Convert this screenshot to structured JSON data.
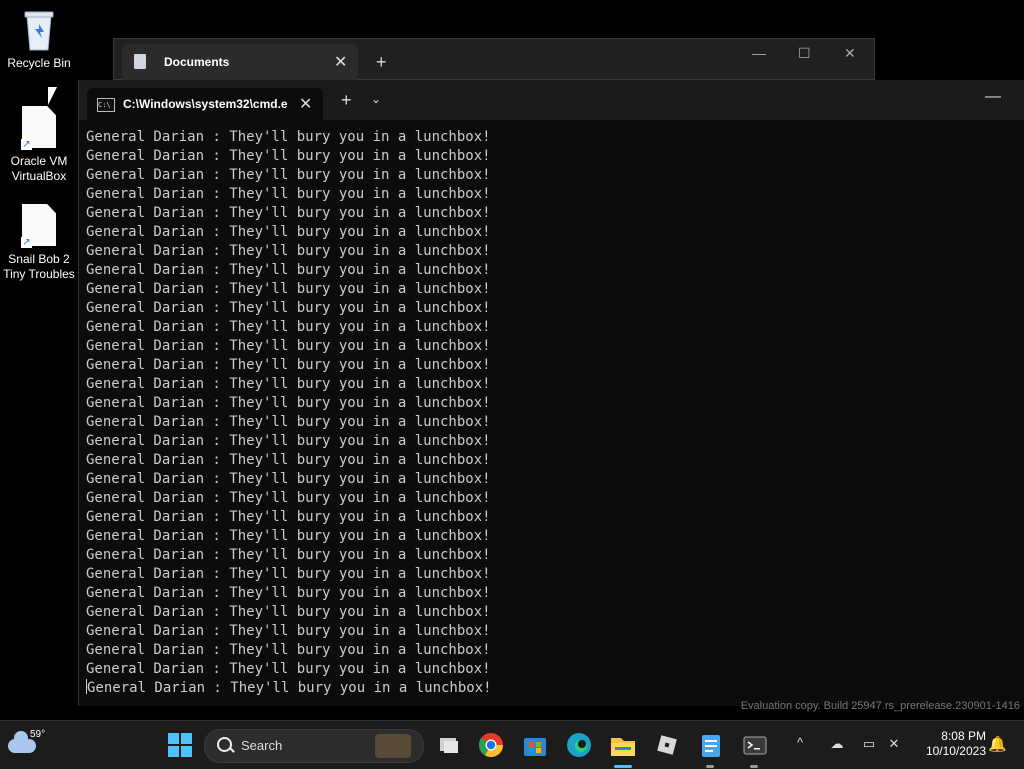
{
  "desktop": {
    "icons": [
      {
        "label": "Recycle Bin",
        "icon": "recycle-bin-icon"
      },
      {
        "label": "Oracle VM VirtualBox",
        "icon": "shortcut-file-icon"
      },
      {
        "label": "Snail Bob 2 Tiny Troubles",
        "icon": "shortcut-file-icon"
      }
    ]
  },
  "documents_window": {
    "tab_title": "Documents",
    "new_tab": "+",
    "close_tab": "✕",
    "minimize": "—",
    "maximize": "☐",
    "close": "✕"
  },
  "terminal": {
    "tab_title": "C:\\Windows\\system32\\cmd.e:",
    "new_tab": "+",
    "dropdown": "⌄",
    "close_tab": "✕",
    "minimize": "—",
    "lines": [
      "General Darian : They'll bury you in a lunchbox!",
      "General Darian : They'll bury you in a lunchbox!",
      "General Darian : They'll bury you in a lunchbox!",
      "General Darian : They'll bury you in a lunchbox!",
      "General Darian : They'll bury you in a lunchbox!",
      "General Darian : They'll bury you in a lunchbox!",
      "General Darian : They'll bury you in a lunchbox!",
      "General Darian : They'll bury you in a lunchbox!",
      "General Darian : They'll bury you in a lunchbox!",
      "General Darian : They'll bury you in a lunchbox!",
      "General Darian : They'll bury you in a lunchbox!",
      "General Darian : They'll bury you in a lunchbox!",
      "General Darian : They'll bury you in a lunchbox!",
      "General Darian : They'll bury you in a lunchbox!",
      "General Darian : They'll bury you in a lunchbox!",
      "General Darian : They'll bury you in a lunchbox!",
      "General Darian : They'll bury you in a lunchbox!",
      "General Darian : They'll bury you in a lunchbox!",
      "General Darian : They'll bury you in a lunchbox!",
      "General Darian : They'll bury you in a lunchbox!",
      "General Darian : They'll bury you in a lunchbox!",
      "General Darian : They'll bury you in a lunchbox!",
      "General Darian : They'll bury you in a lunchbox!",
      "General Darian : They'll bury you in a lunchbox!",
      "General Darian : They'll bury you in a lunchbox!",
      "General Darian : They'll bury you in a lunchbox!",
      "General Darian : They'll bury you in a lunchbox!",
      "General Darian : They'll bury you in a lunchbox!",
      "General Darian : They'll bury you in a lunchbox!",
      "General Darian : They'll bury you in a lunchbox!"
    ]
  },
  "watermark": "Evaluation copy. Build 25947.rs_prerelease.230901-1416",
  "taskbar": {
    "weather_temp": "59°",
    "search_label": "Search",
    "apps": [
      {
        "name": "task-view",
        "color": "#d0d0d0"
      },
      {
        "name": "chrome",
        "color": "#e33b2e"
      },
      {
        "name": "microsoft-store",
        "color": "#2b88d8"
      },
      {
        "name": "edge",
        "color": "#1aa2c9"
      },
      {
        "name": "file-explorer",
        "color": "#f5c342"
      },
      {
        "name": "roblox",
        "color": "#d8d8d8"
      },
      {
        "name": "notepad",
        "color": "#4aa6e8"
      },
      {
        "name": "terminal",
        "color": "#3a3a3a"
      }
    ],
    "tray": {
      "chevron": "^"
    },
    "clock_time": "8:08 PM",
    "clock_date": "10/10/2023"
  },
  "colors": {
    "accent": "#4cc2ff",
    "terminal_text": "#cccccc",
    "terminal_bg": "#0c0c0c"
  }
}
